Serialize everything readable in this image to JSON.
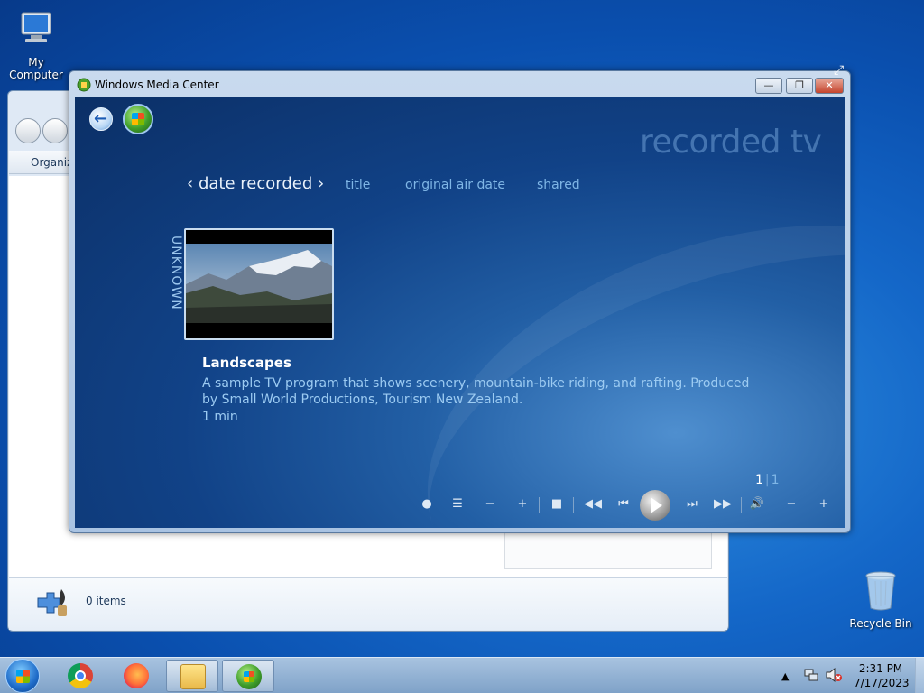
{
  "desktop": {
    "icons": [
      {
        "label": "My Computer",
        "icon": "computer-icon"
      },
      {
        "label": "Recycle Bin",
        "icon": "recycle-bin-icon"
      }
    ]
  },
  "explorer": {
    "toolbar_label": "Organiz",
    "status_text": "0 items"
  },
  "wmc": {
    "window_title": "Windows Media Center",
    "caption_buttons": {
      "minimize": "—",
      "maximize": "❐",
      "close": "✕"
    },
    "section_title": "recorded tv",
    "pivots": {
      "active": "date recorded",
      "prev_glyph": "‹",
      "next_glyph": "›",
      "items": [
        "title",
        "original air date",
        "shared"
      ]
    },
    "group_label": "UNKNOWN",
    "program": {
      "title": "Landscapes",
      "description": "A sample TV program that shows scenery, mountain-bike riding, and rafting. Produced by Small World Productions, Tourism New Zealand.",
      "length": "1 min"
    },
    "pager": {
      "current": "1",
      "separator": "|",
      "total": "1"
    },
    "transport": {
      "record": "●",
      "guide": "☰",
      "ch_down": "−",
      "ch_up": "+",
      "stop": "■",
      "rewind": "◀◀",
      "prev": "⏮",
      "next": "⏭",
      "ffwd": "▶▶",
      "volume": "🔊",
      "vol_down": "−",
      "vol_up": "+"
    }
  },
  "taskbar": {
    "apps": [
      "chrome-icon",
      "firefox-icon",
      "file-explorer-icon",
      "windows-media-center-icon"
    ],
    "clock_time": "2:31 PM",
    "clock_date": "7/17/2023"
  }
}
